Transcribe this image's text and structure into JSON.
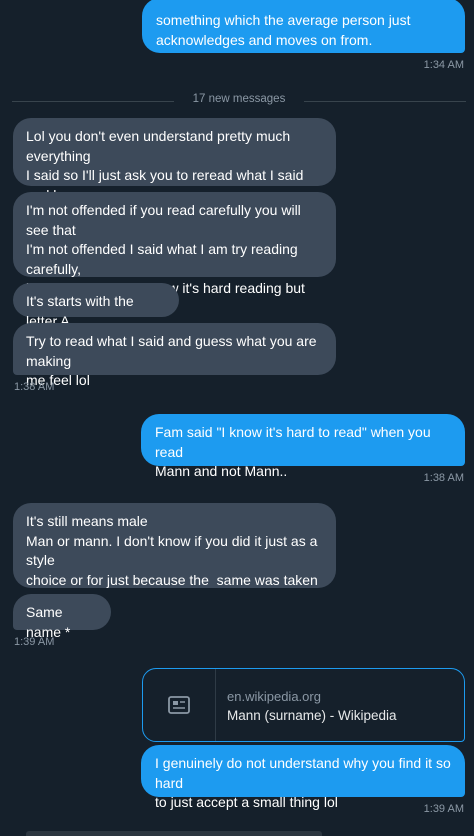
{
  "messages": {
    "top_out": "something which the average person just\nacknowledges and moves on from.",
    "time_1": "1:34 AM",
    "new_messages_label": "17 new messages",
    "in_1": "Lol you don't even understand pretty much everything\nI said so I'll just ask you to reread what I said and have\na nice day",
    "in_2": "I'm not offended if you read carefully you will see that\nI'm not offended I said what I am try reading carefully,\njust try you know ,I know it's hard reading but just try\nlol",
    "in_3": "It's starts with the letter A",
    "in_4": "Try to read what I said and guess what you are making\nme feel lol",
    "time_2": "1:38 AM",
    "out_1": "Fam said \"I know it's hard to read\" when you read\nMann and not Mann..",
    "time_3": "1:38 AM",
    "in_5": "It's still means male\nMan or mann. I don't know if you did it just as a style\nchoice or for just because the  same was taken or\nsomething",
    "in_6": "Same name *",
    "time_4": "1:39 AM",
    "link_card": {
      "domain": "en.wikipedia.org",
      "title": "Mann (surname) - Wikipedia",
      "icon": "article-icon"
    },
    "out_2": "I genuinely do not understand why you find it so hard\nto just accept a small thing lol",
    "time_5": "1:39 AM"
  },
  "colors": {
    "background": "#15202b",
    "incoming_bubble": "#3d4a5a",
    "outgoing_bubble": "#1d9bf0",
    "timestamp": "#8b98a5"
  }
}
